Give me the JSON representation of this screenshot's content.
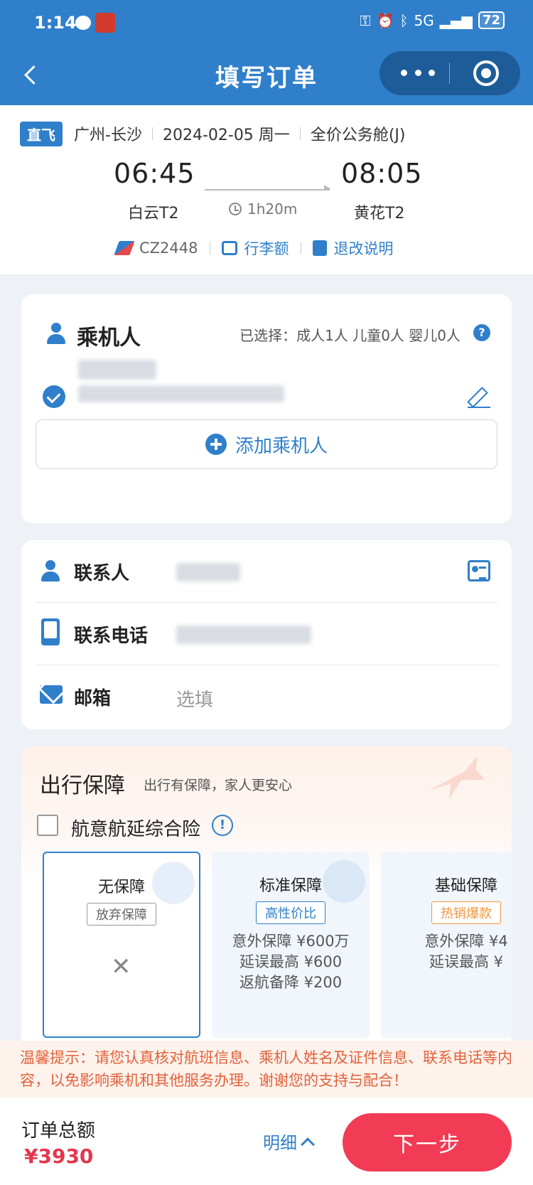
{
  "status_bar": {
    "time": "1:14",
    "battery": "72",
    "network": "5G"
  },
  "header": {
    "title": "填写订单"
  },
  "flight": {
    "tag": "直飞",
    "route": "广州-长沙",
    "date": "2024-02-05 周一",
    "cabin": "全价公务舱(J)",
    "dep_time": "06:45",
    "arr_time": "08:05",
    "dep_airport": "白云T2",
    "arr_airport": "黄花T2",
    "duration": "1h20m",
    "flight_no": "CZ2448",
    "baggage_label": "行李额",
    "refund_label": "退改说明"
  },
  "passengers": {
    "title": "乘机人",
    "selected": "已选择：成人1人 儿童0人 婴儿0人",
    "add_label": "添加乘机人"
  },
  "contact": {
    "name_label": "联系人",
    "phone_label": "联系电话",
    "email_label": "邮箱",
    "email_placeholder": "选填"
  },
  "insurance": {
    "title": "出行保障",
    "subtitle": "出行有保障，家人更安心",
    "product": "航意航延综合险",
    "plans": [
      {
        "name": "无保障",
        "badge": "放弃保障"
      },
      {
        "name": "标准保障",
        "badge": "高性价比",
        "lines": [
          "意外保障 ¥600万",
          "延误最高 ¥600",
          "返航备降 ¥200"
        ]
      },
      {
        "name": "基础保障",
        "badge": "热销爆款",
        "lines": [
          "意外保障 ¥4",
          "延误最高 ¥"
        ]
      }
    ]
  },
  "notice": "温馨提示：请您认真核对航班信息、乘机人姓名及证件信息、联系电话等内容，以免影响乘机和其他服务办理。谢谢您的支持与配合！",
  "footer": {
    "total_label": "订单总额",
    "total": "¥3930",
    "detail_label": "明细",
    "next_label": "下一步"
  },
  "colors": {
    "primary": "#2f7fca",
    "accent": "#f23b55",
    "notice": "#e2623a"
  }
}
